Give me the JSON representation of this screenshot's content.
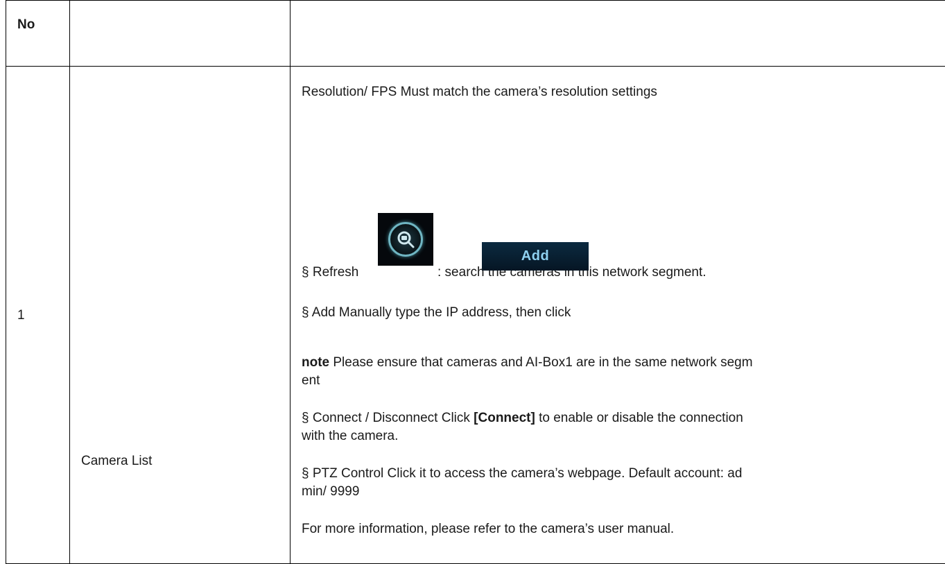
{
  "table": {
    "header": {
      "no": "No",
      "name": "",
      "desc": ""
    },
    "row": {
      "no": "1",
      "name": "Camera List",
      "lines": {
        "resolution": "Resolution/ FPS  Must match the camera’s resolution settings",
        "refresh_pre": "§ Refresh",
        "refresh_post": ": search the cameras in this network segment.",
        "add": "§ Add  Manually type the IP address, then click",
        "add_button": "Add",
        "note_bold": "note",
        "note_a": " Please ensure that cameras and AI-Box1 are in the same network segm",
        "note_b": "ent",
        "connect_a": "§  Connect / Disconnect  Click ",
        "connect_bold": "[Connect]",
        "connect_b": " to enable or disable the connection",
        "connect_c": "with the camera.",
        "ptz_a": "§ PTZ Control  Click it to access the camera’s webpage. Default account: ad",
        "ptz_b": "min/ 9999",
        "more": "For more information, please refer to the camera’s user manual."
      }
    }
  },
  "icons": {
    "refresh": "magnifier-camera-icon"
  },
  "colors": {
    "icon_bg": "#05080c",
    "icon_ring": "#6fb5c2",
    "add_text": "#8fd1f0"
  }
}
